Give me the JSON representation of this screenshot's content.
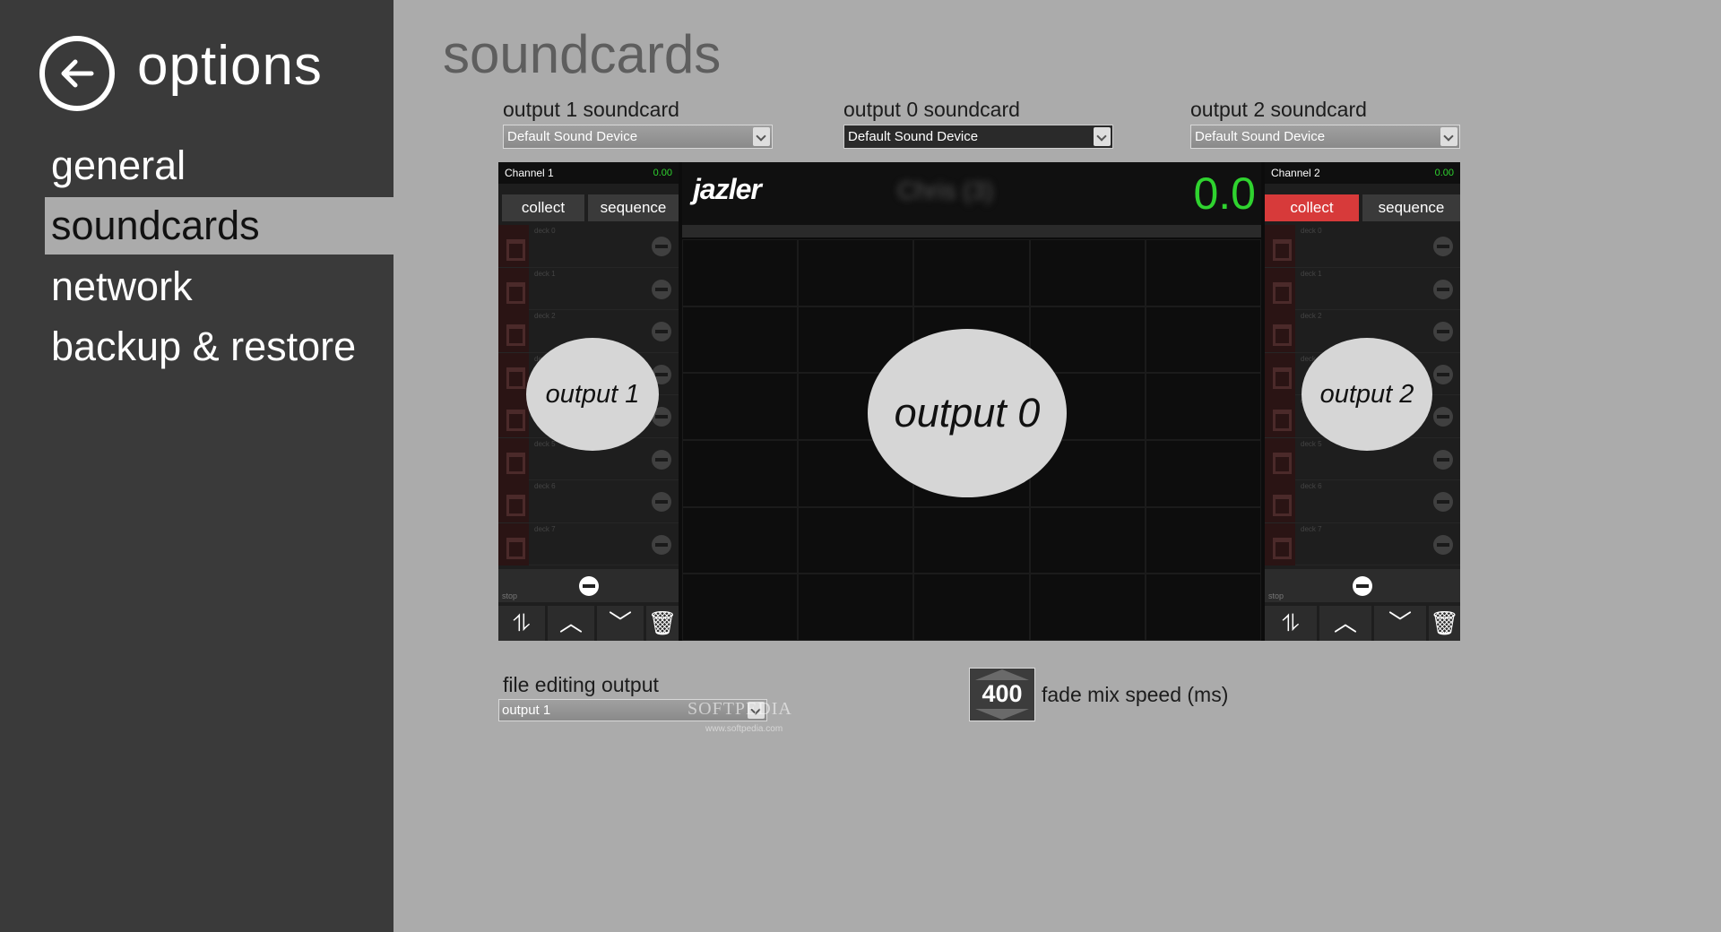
{
  "sidebar": {
    "title": "options",
    "items": [
      {
        "label": "general"
      },
      {
        "label": "soundcards",
        "active": true
      },
      {
        "label": "network"
      },
      {
        "label": "backup & restore"
      }
    ]
  },
  "main": {
    "title": "soundcards",
    "soundcards": [
      {
        "label": "output 1 soundcard",
        "value": "Default Sound Device"
      },
      {
        "label": "output 0 soundcard",
        "value": "Default Sound Device"
      },
      {
        "label": "output 2 soundcard",
        "value": "Default Sound Device"
      }
    ],
    "preview": {
      "channel1": {
        "name": "Channel 1",
        "value": "0.00",
        "collect": "collect",
        "sequence": "sequence",
        "stop": "stop"
      },
      "channel2": {
        "name": "Channel 2",
        "value": "0.00",
        "collect": "collect",
        "sequence": "sequence",
        "stop": "stop"
      },
      "decks": [
        "deck 0",
        "deck 1",
        "deck 2",
        "deck 3",
        "deck 4",
        "deck 5",
        "deck 6",
        "deck 7"
      ],
      "logo": "jazler",
      "blurred_title": "Chris (3)",
      "big_number": "0.0",
      "bubbles": {
        "left": "output 1",
        "center": "output 0",
        "right": "output 2"
      },
      "tool_icons": [
        "sort-icon",
        "arrow-up-icon",
        "arrow-down-icon",
        "trash-icon"
      ]
    },
    "file_editing": {
      "label": "file editing output",
      "value": "output 1"
    },
    "fade": {
      "value": "400",
      "label": "fade mix speed (ms)"
    },
    "watermark": {
      "text": "SOFTPEDIA",
      "sub": "www.softpedia.com"
    }
  },
  "colors": {
    "sidebar_bg": "#3a3a3a",
    "main_bg": "#ababab",
    "accent_red": "#d73a3a",
    "accent_green": "#2fd32f"
  }
}
